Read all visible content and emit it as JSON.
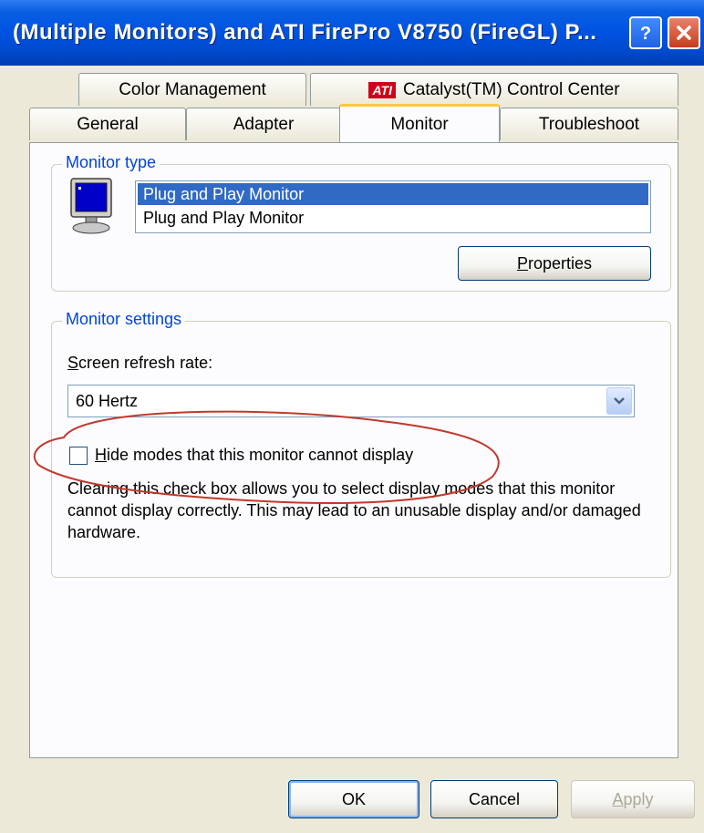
{
  "window": {
    "title": "(Multiple Monitors) and ATI FirePro V8750 (FireGL) P...",
    "help_button": "?",
    "close_button": "X"
  },
  "tabs_top": [
    {
      "label": "Color Management"
    },
    {
      "label": "Catalyst(TM) Control Center",
      "icon": "ati-logo-icon",
      "icon_text": "ATI"
    }
  ],
  "tabs_bottom": [
    {
      "label": "General"
    },
    {
      "label": "Adapter"
    },
    {
      "label": "Monitor",
      "active": true
    },
    {
      "label": "Troubleshoot"
    }
  ],
  "monitor_type": {
    "group_label": "Monitor type",
    "icon": "monitor-icon",
    "items": [
      "Plug and Play Monitor",
      "Plug and Play Monitor"
    ],
    "selected_index": 0,
    "properties_mnemonic": "P",
    "properties_rest": "roperties"
  },
  "monitor_settings": {
    "group_label": "Monitor settings",
    "refresh_label_mnemonic": "S",
    "refresh_label_rest": "creen refresh rate:",
    "refresh_value": "60 Hertz",
    "hide_modes_mnemonic": "H",
    "hide_modes_rest": "ide modes that this monitor cannot display",
    "hide_modes_checked": false,
    "description": "Clearing this check box allows you to select display modes that this monitor cannot display correctly. This may lead to an unusable display and/or damaged hardware."
  },
  "buttons": {
    "ok": "OK",
    "cancel": "Cancel",
    "apply_mnemonic": "A",
    "apply_rest": "pply",
    "apply_enabled": false
  },
  "colors": {
    "title_bar": "#0054e3",
    "active_tab_accent": "#ffc83c",
    "group_label": "#0046d5",
    "selection": "#316ac5",
    "annotation_ellipse": "#c0392b"
  }
}
